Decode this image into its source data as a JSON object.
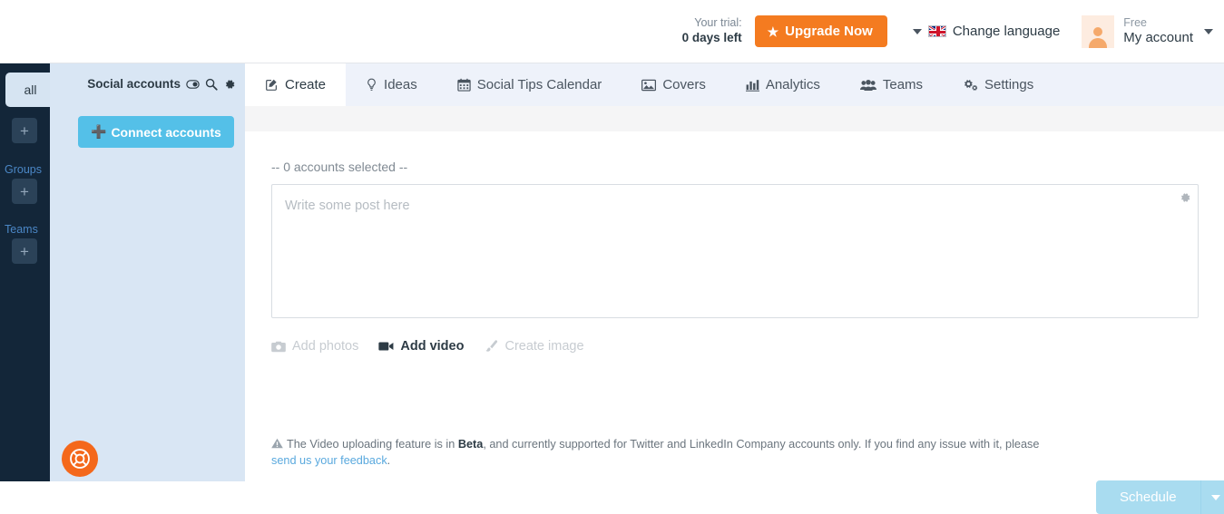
{
  "header": {
    "trial_label": "Your trial:",
    "trial_value": "0 days left",
    "upgrade_label": "Upgrade Now",
    "upgrade_color": "#f47b20",
    "language_label": "Change language",
    "language_flag": "uk-flag-icon",
    "account_plan": "Free",
    "account_label": "My account"
  },
  "rail": {
    "all_label": "all",
    "add_account_label": "+",
    "groups_label": "Groups",
    "add_group_label": "+",
    "teams_label": "Teams",
    "add_team_label": "+",
    "help_icon": "lifebuoy-icon",
    "background_color": "#132639"
  },
  "left_panel": {
    "title": "Social accounts",
    "toggle_icon": "toggle-switch-icon",
    "search_icon": "search-icon",
    "settings_icon": "gear-icon",
    "connect_button": "Connect accounts",
    "connect_button_color": "#54c0e8"
  },
  "tabs": [
    {
      "label": "Create",
      "icon": "pencil-square-icon",
      "active": true
    },
    {
      "label": "Ideas",
      "icon": "lightbulb-icon",
      "active": false
    },
    {
      "label": "Social Tips Calendar",
      "icon": "calendar-icon",
      "active": false
    },
    {
      "label": "Covers",
      "icon": "image-icon",
      "active": false
    },
    {
      "label": "Analytics",
      "icon": "bar-chart-icon",
      "active": false
    },
    {
      "label": "Teams",
      "icon": "users-icon",
      "active": false
    },
    {
      "label": "Settings",
      "icon": "gears-icon",
      "active": false
    }
  ],
  "composer": {
    "accounts_selected": "-- 0 accounts selected --",
    "post_placeholder": "Write some post here",
    "post_value": "",
    "settings_icon": "gear-icon",
    "media": [
      {
        "label": "Add photos",
        "icon": "camera-icon",
        "state": "disabled"
      },
      {
        "label": "Add video",
        "icon": "video-camera-icon",
        "state": "active"
      },
      {
        "label": "Create image",
        "icon": "paintbrush-icon",
        "state": "disabled"
      }
    ],
    "beta_notice": {
      "icon": "warning-triangle-icon",
      "part1": "The Video uploading feature is in ",
      "bold": "Beta",
      "part2": ", and currently supported for Twitter and LinkedIn Company accounts only. If you find any issue with it, please ",
      "link": "send us your feedback",
      "part3": "."
    },
    "schedule_label": "Schedule",
    "schedule_color": "#a9dcf0",
    "schedule_caret_icon": "chevron-down-icon"
  }
}
